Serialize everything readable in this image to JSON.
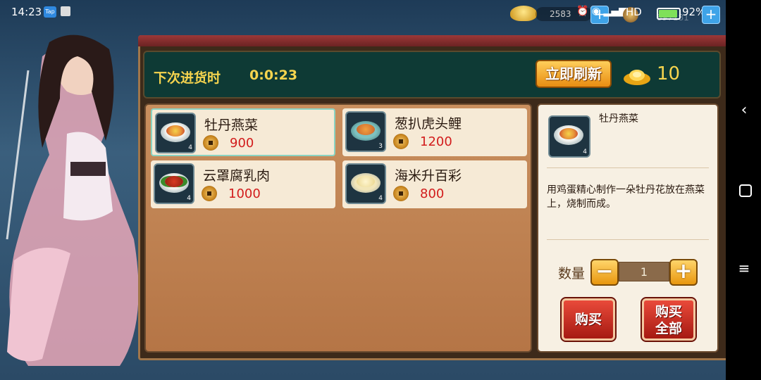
{
  "status_bar": {
    "time": "14:23",
    "app_icon": "Tap",
    "currency_value": "2583",
    "network": "HD",
    "battery": "92%",
    "bg_value": "897181"
  },
  "header": {
    "next_restock_label": "下次进货时",
    "timer": "0:0:23",
    "refresh_button": "立即刷新",
    "gold_count": "10"
  },
  "items": [
    {
      "name": "牡丹燕菜",
      "price": "900",
      "qty": "4",
      "food_color": "#e8963a",
      "selected": true
    },
    {
      "name": "葱扒虎头鲤",
      "price": "1200",
      "qty": "3",
      "food_color": "#d8762a",
      "selected": false
    },
    {
      "name": "云罩腐乳肉",
      "price": "1000",
      "qty": "4",
      "food_color": "#b8301c",
      "selected": false
    },
    {
      "name": "海米升百彩",
      "price": "800",
      "qty": "4",
      "food_color": "#e8d48a",
      "selected": false
    }
  ],
  "detail": {
    "name": "牡丹燕菜",
    "qty_badge": "4",
    "description": "用鸡蛋精心制作一朵牡丹花放在燕菜上，烧制而成。",
    "quantity_label": "数量",
    "quantity_value": "1",
    "minus_symbol": "−",
    "plus_symbol": "+",
    "buy_label": "购买",
    "buy_all_line1": "购买",
    "buy_all_line2": "全部"
  },
  "colors": {
    "accent_gold": "#f6d44e",
    "price_red": "#d21c1c",
    "header_bg": "#0e3a35"
  }
}
